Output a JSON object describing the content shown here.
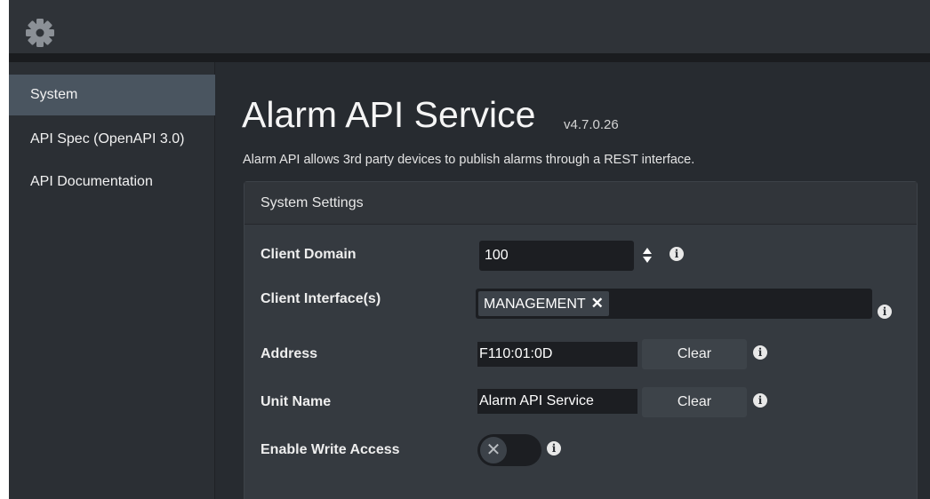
{
  "header": {
    "settings_icon": "gear-icon"
  },
  "sidebar": {
    "items": [
      {
        "label": "System",
        "active": true
      },
      {
        "label": "API Spec (OpenAPI 3.0)",
        "active": false
      },
      {
        "label": "API Documentation",
        "active": false
      }
    ]
  },
  "main": {
    "title": "Alarm API Service",
    "version": "v4.7.0.26",
    "description": "Alarm API allows 3rd party devices to publish alarms through a REST interface."
  },
  "settings": {
    "panel_title": "System Settings",
    "client_domain": {
      "label": "Client Domain",
      "value": "100",
      "info_glyph": "i"
    },
    "client_interfaces": {
      "label": "Client Interface(s)",
      "tags": [
        {
          "text": "MANAGEMENT",
          "remove_glyph": "✕"
        }
      ],
      "info_glyph": "i"
    },
    "address": {
      "label": "Address",
      "value": "F110:01:0D",
      "clear_label": "Clear",
      "info_glyph": "i"
    },
    "unit_name": {
      "label": "Unit Name",
      "value": "Alarm API Service",
      "clear_label": "Clear",
      "info_glyph": "i"
    },
    "write_access": {
      "label": "Enable Write Access",
      "enabled": false,
      "knob_glyph": "✕",
      "info_glyph": "i"
    }
  },
  "colors": {
    "background": "#272b30",
    "sidebar": "#2b2f34",
    "active_nav": "#4a5560",
    "panel": "#353a40",
    "input": "#1c1e22",
    "button": "#3d4349"
  }
}
